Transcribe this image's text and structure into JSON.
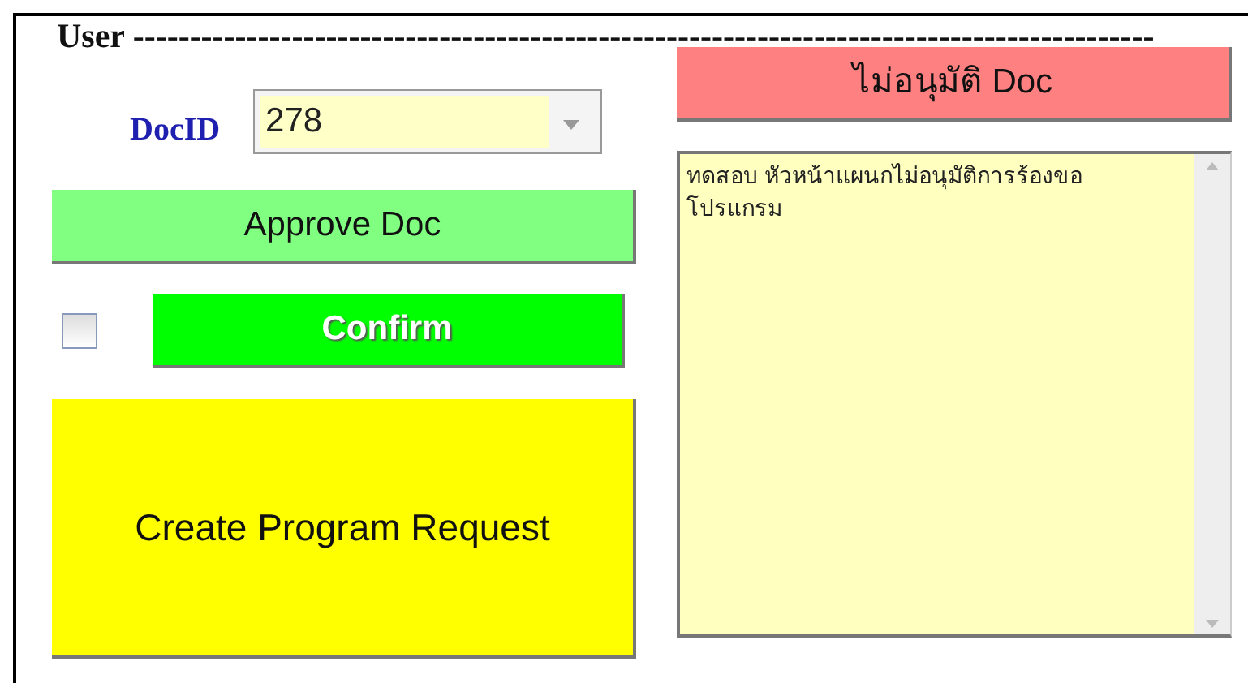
{
  "heading": "User ------------------------------------------------------------------------------------------",
  "doc_id": {
    "label": "DocID",
    "value": "278"
  },
  "approve_button": "Approve Doc",
  "confirm": {
    "checked": false,
    "button": "Confirm"
  },
  "create_button": "Create Program Request",
  "reject_button": "ไม่อนุมัติ Doc",
  "comment": {
    "value": "ทดสอบ หัวหน้าแผนกไม่อนุมัติการร้องขอโปรแกรม"
  }
}
